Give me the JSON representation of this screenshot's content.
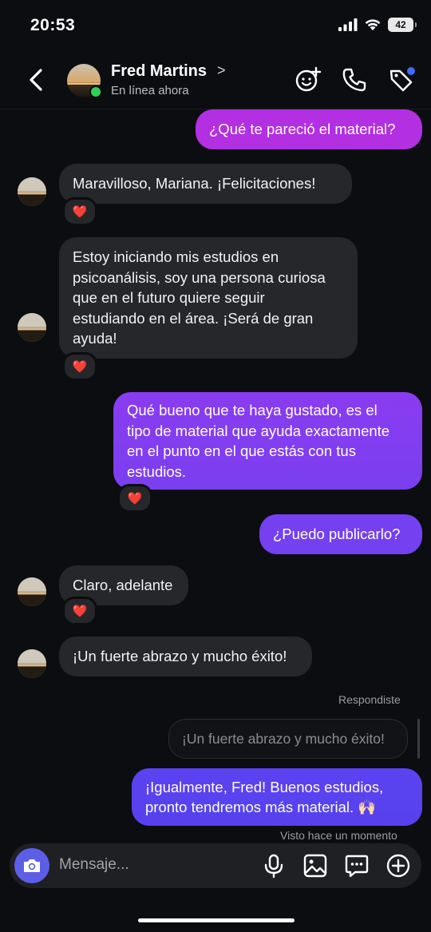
{
  "status_bar": {
    "time": "20:53",
    "battery": "42"
  },
  "header": {
    "contact_name": "Fred Martins",
    "status": "En línea ahora"
  },
  "messages": [
    {
      "side": "out",
      "text": "¿Qué te pareció el material?"
    },
    {
      "side": "in",
      "text": "Maravilloso, Mariana. ¡Felicitaciones!",
      "reaction": "❤️"
    },
    {
      "side": "in",
      "lines": [
        "Estoy iniciando mis estudios en",
        "psicoanálisis, soy una persona curiosa",
        "que en el futuro quiere seguir",
        "estudiando en el área. ¡Será de gran",
        "ayuda!"
      ],
      "reaction": "❤️"
    },
    {
      "side": "out",
      "lines": [
        "Qué bueno que te haya gustado, es el",
        "tipo de material que ayuda exactamente",
        "en el punto en el que estás con tus",
        "estudios."
      ],
      "reaction": "❤️"
    },
    {
      "side": "out",
      "text": "¿Puedo publicarlo?"
    },
    {
      "side": "in",
      "text": "Claro, adelante",
      "reaction": "❤️"
    },
    {
      "side": "in",
      "text": "¡Un fuerte abrazo y mucho éxito!"
    },
    {
      "side": "out",
      "reply_label": "Respondiste",
      "quoted": "¡Un fuerte abrazo y mucho éxito!",
      "lines": [
        "¡Igualmente, Fred! Buenos estudios,",
        "pronto tendremos más material. 🙌🏻"
      ]
    }
  ],
  "seen_status": "Visto hace un momento",
  "composer": {
    "placeholder": "Mensaje..."
  },
  "colors": {
    "out_gradient_top": "#b42ee0",
    "out_gradient_mid": "#8a3cf0",
    "out_gradient_bottom": "#5a41f0",
    "incoming": "#26272b",
    "camera_button": "#5c5fe6",
    "online": "#2fd254"
  }
}
